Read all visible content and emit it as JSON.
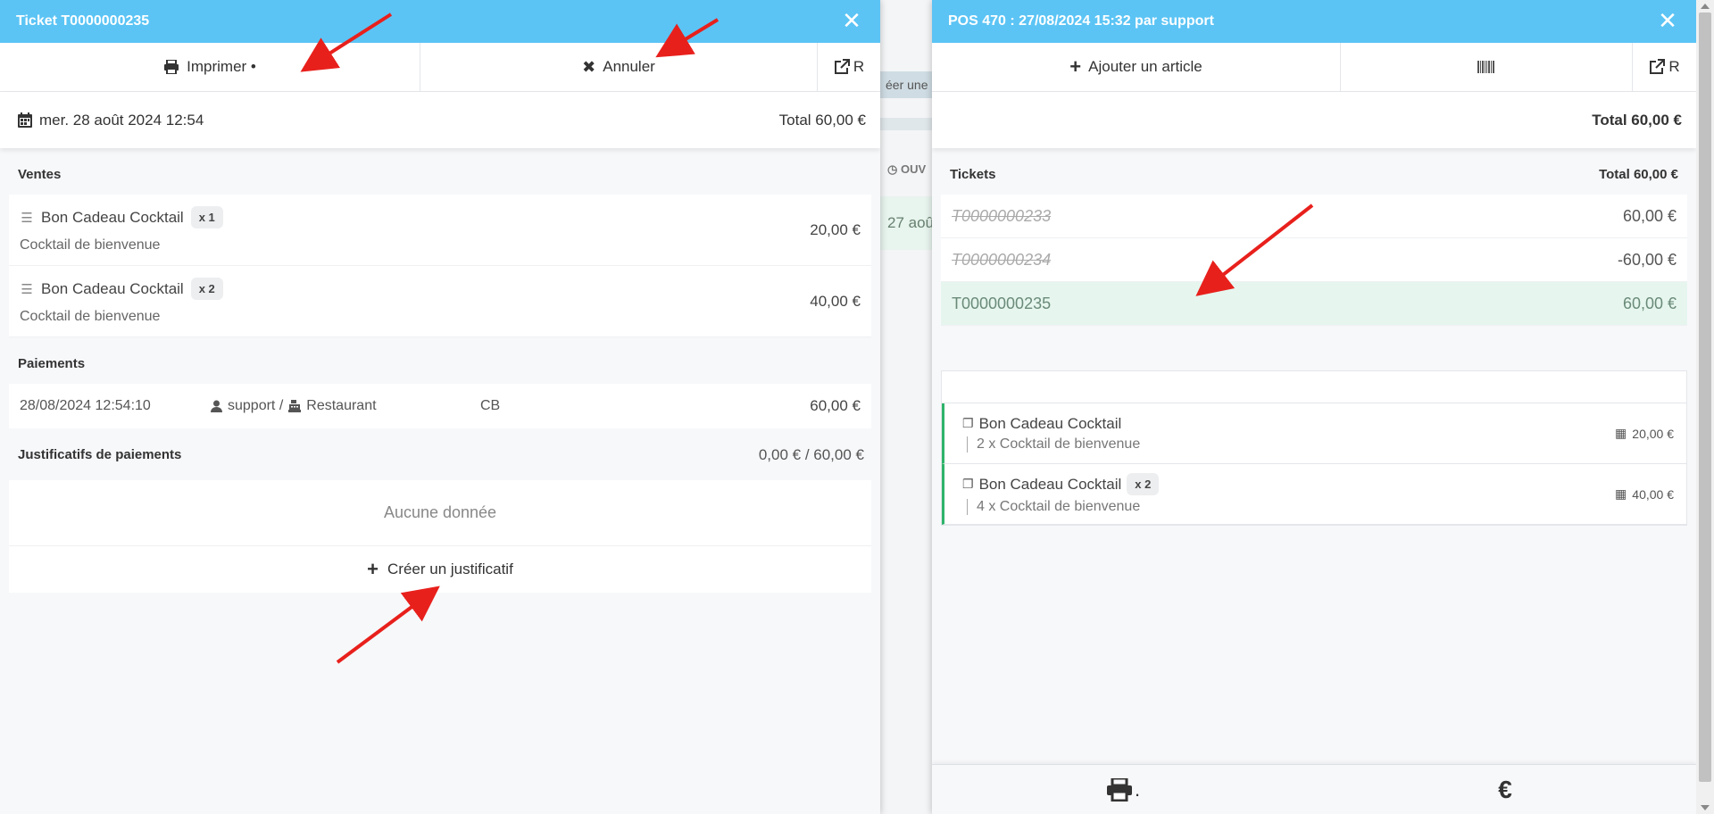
{
  "background": {
    "strip_text": "éer une c",
    "ouv_label": "◷ OUV",
    "row_date": "27 aoû"
  },
  "left_panel": {
    "title": "Ticket T0000000235",
    "toolbar": {
      "print_label": "Imprimer •",
      "cancel_label": "Annuler",
      "open_label": "R"
    },
    "date": "mer. 28 août 2024 12:54",
    "total": "Total 60,00 €",
    "sales_title": "Ventes",
    "sales": [
      {
        "name": "Bon Cadeau Cocktail",
        "qty": "x 1",
        "desc": "Cocktail de bienvenue",
        "amount": "20,00 €"
      },
      {
        "name": "Bon Cadeau Cocktail",
        "qty": "x 2",
        "desc": "Cocktail de bienvenue",
        "amount": "40,00 €"
      }
    ],
    "payments_title": "Paiements",
    "payments": [
      {
        "datetime": "28/08/2024 12:54:10",
        "user": "support /",
        "place": "Restaurant",
        "method": "CB",
        "amount": "60,00 €"
      }
    ],
    "proofs_title": "Justificatifs de paiements",
    "proofs_amount": "0,00 € / 60,00 €",
    "proofs_empty": "Aucune donnée",
    "create_proof_label": "Créer un justificatif"
  },
  "right_panel": {
    "title": "POS 470 : 27/08/2024 15:32 par support",
    "toolbar": {
      "add_label": "Ajouter un article",
      "open_label": "R"
    },
    "total": "Total 60,00 €",
    "tickets_title": "Tickets",
    "tickets_total": "Total 60,00 €",
    "tickets": [
      {
        "number": "T0000000233",
        "amount": "60,00 €"
      },
      {
        "number": "T0000000234",
        "amount": "-60,00 €"
      },
      {
        "number": "T0000000235",
        "amount": "60,00 €"
      }
    ],
    "items": [
      {
        "name": "Bon Cadeau Cocktail",
        "qty": "",
        "sub": "2 x Cocktail de bienvenue",
        "amount": "20,00 €"
      },
      {
        "name": "Bon Cadeau Cocktail",
        "qty": "x 2",
        "sub": "4 x Cocktail de bienvenue",
        "amount": "40,00 €"
      }
    ],
    "bottom": {
      "print_dot": ".",
      "euro": "€"
    }
  },
  "colors": {
    "titlebar": "#5bc4f5",
    "active_ticket": "#e6f6ef",
    "item_border": "#2fb36a",
    "annotation_arrow": "#e8201c"
  }
}
